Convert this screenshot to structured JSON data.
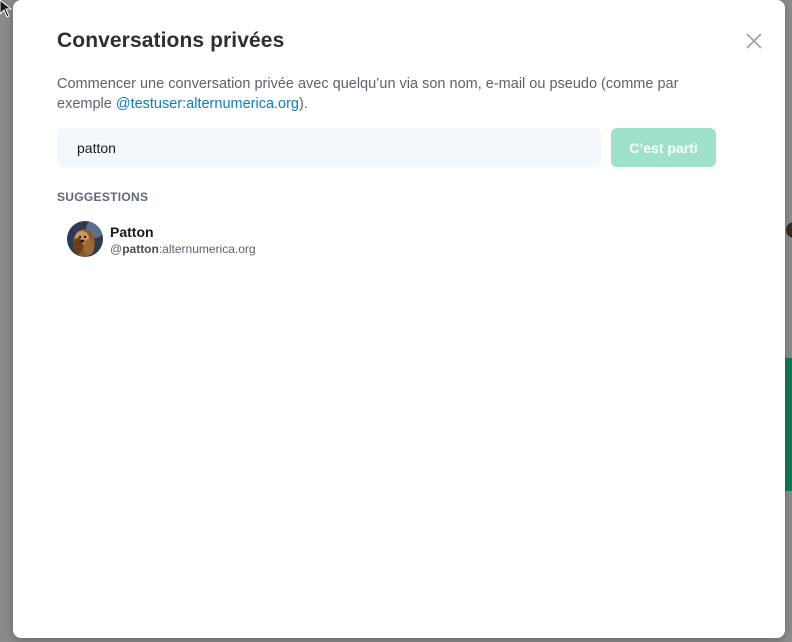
{
  "dialog": {
    "title": "Conversations privées",
    "description_prefix": "Commencer une conversation privée avec quelqu’un via son nom, e-mail ou pseudo (comme par exemple ",
    "description_link": "@testuser:alternumerica.org",
    "description_suffix": ").",
    "search": {
      "value": "patton",
      "placeholder": ""
    },
    "go_label": "C’est parti",
    "suggestions_label": "SUGGESTIONS",
    "suggestions": [
      {
        "name": "Patton",
        "id_at": "@",
        "id_match": "patton",
        "id_rest": ":alternumerica.org"
      }
    ]
  },
  "colors": {
    "accent": "#0dbd8b",
    "button_disabled": "#9fe2cc",
    "link": "#0d7cc7",
    "input_bg": "#f3f8fd"
  },
  "icons": {
    "close": "close-icon",
    "avatar": "avatar-image"
  }
}
